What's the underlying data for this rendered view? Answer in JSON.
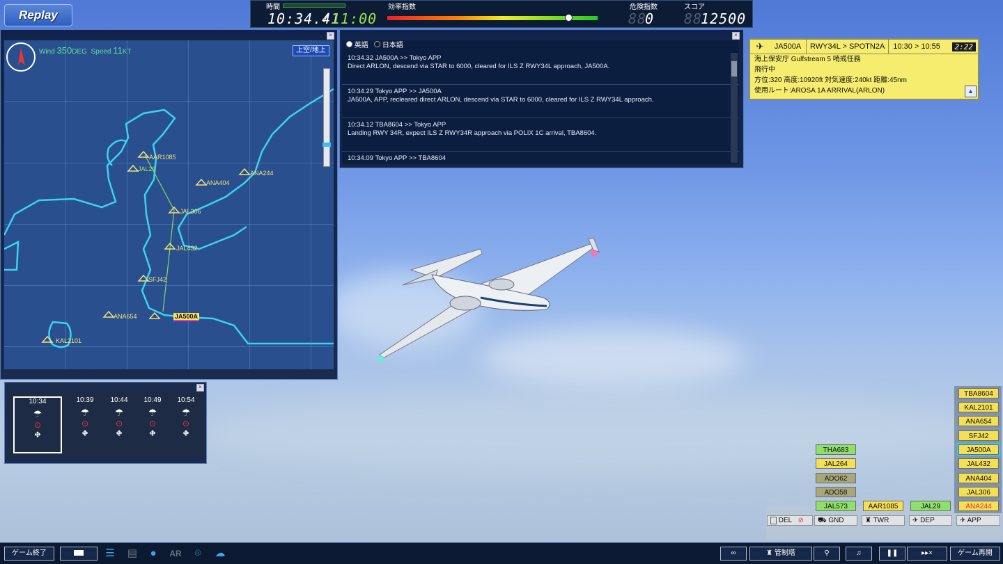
{
  "replay_label": "Replay",
  "topbar": {
    "time_label": "時間",
    "efficiency_label": "効率指数",
    "danger_label": "危険指数",
    "score_label": "スコア",
    "current_time": "10:34.41",
    "slash": "/",
    "end_time": "11:00",
    "efficiency_level": 0.86,
    "danger_ghost": "88",
    "danger_value": "0",
    "score_ghost": "88",
    "score_value": "12500"
  },
  "map": {
    "wind_prefix": "Wind",
    "wind_value": "350",
    "wind_unit": "DEG",
    "speed_prefix": "Speed",
    "speed_value": "11",
    "speed_unit": "KT",
    "toggle_label": "上空/地上",
    "aircraft": [
      "AAR1085",
      "JAL29",
      "ANA404",
      "ANA244",
      "JAL306",
      "JAL432",
      "SFJ42",
      "ANA654",
      "JA500A",
      "KAL2101"
    ]
  },
  "messages": {
    "lang_english": "英語",
    "lang_japanese": "日本語",
    "items": [
      {
        "header": "10:34.32  JA500A >> Tokyo APP",
        "body": "Direct ARLON, descend via STAR to 6000, cleared for ILS Z RWY34L approach, JA500A."
      },
      {
        "header": "10:34.29  Tokyo APP >> JA500A",
        "body": "JA500A, APP, recleared direct ARLON, descend via STAR to 6000, cleared for ILS Z RWY34L approach."
      },
      {
        "header": "10:34.12  TBA8604 >> Tokyo APP",
        "body": "Landing RWY 34R, expect ILS Z RWY34R approach via POLIX 1C arrival, TBA8604."
      },
      {
        "header": "10:34.09  Tokyo APP >> TBA8604",
        "body": ""
      }
    ]
  },
  "card": {
    "callsign": "JA500A",
    "route": "RWY34L > SPOTN2A",
    "times": "10:30 > 10:55",
    "timer": "2:22",
    "line1": "海上保安庁 Gulfstream 5 哨戒任務",
    "line2": "飛行中",
    "line3": "方位:320 高度:10920ft 対気速度:240kt 距離:45nm",
    "line4": "使用ルート:AROSA 1A ARRIVAL(ARLON)"
  },
  "forecast": {
    "times": [
      "10:34",
      "10:39",
      "10:44",
      "10:49",
      "10:54"
    ]
  },
  "strips": {
    "app": [
      "TBA8604",
      "KAL2101",
      "ANA654",
      "SFJ42",
      "JA500A",
      "JAL432",
      "ANA404",
      "JAL306",
      "ANA244"
    ],
    "gnd": [
      "THA683",
      "JAL264",
      "ADO62",
      "ADO58",
      "JAL573"
    ],
    "twr": [
      "AAR1085"
    ],
    "dep": [
      "JAL29"
    ]
  },
  "tabs": {
    "del": "DEL",
    "gnd": "GND",
    "twr": "TWR",
    "dep": "DEP",
    "app": "APP"
  },
  "bottombar": {
    "quit_label": "ゲーム終了",
    "ar_label": "AR",
    "tower_label": "管制塔",
    "resume_label": "ゲーム再開",
    "ff_label": "▸▸×"
  }
}
